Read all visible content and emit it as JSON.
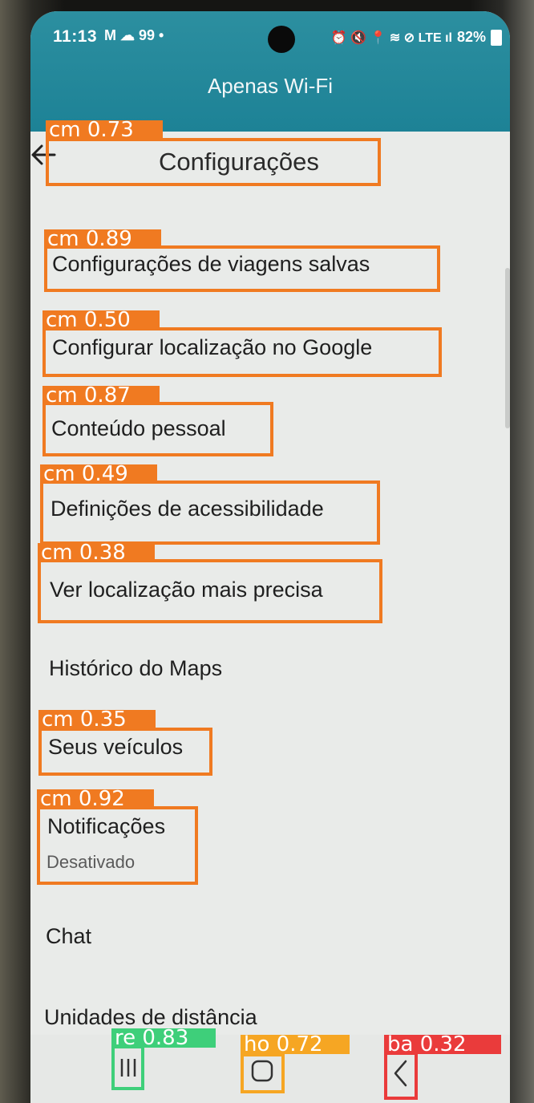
{
  "status_bar": {
    "time": "11:13",
    "left_icons": "M ☁ 99 •",
    "right_icons": "⏰ 🔇 📍 ≋ ⊘ LTE ıl",
    "battery": "82%"
  },
  "app_bar": {
    "title": "Apenas Wi-Fi"
  },
  "header": {
    "back_icon": "arrow-left-icon",
    "title": "Configurações"
  },
  "menu": [
    {
      "label": "Configurações de viagens salvas"
    },
    {
      "label": "Configurar localização no Google"
    },
    {
      "label": "Conteúdo pessoal"
    },
    {
      "label": "Definições de acessibilidade"
    },
    {
      "label": "Ver localização mais precisa"
    },
    {
      "label": "Histórico do Maps"
    },
    {
      "label": "Seus veículos"
    },
    {
      "label": "Notificações",
      "sublabel": "Desativado"
    },
    {
      "label": "Chat"
    },
    {
      "label": "Unidades de distância"
    }
  ],
  "detections": [
    {
      "label": "cm 0.73",
      "color": "#f07a21"
    },
    {
      "label": "cm 0.89",
      "color": "#f07a21"
    },
    {
      "label": "cm 0.50",
      "color": "#f07a21"
    },
    {
      "label": "cm 0.87",
      "color": "#f07a21"
    },
    {
      "label": "cm 0.49",
      "color": "#f07a21"
    },
    {
      "label": "cm 0.38",
      "color": "#f07a21"
    },
    {
      "label": "cm 0.35",
      "color": "#f07a21"
    },
    {
      "label": "cm 0.92",
      "color": "#f07a21"
    },
    {
      "label": "re 0.83",
      "color": "#3ecf7a"
    },
    {
      "label": "ho 0.72",
      "color": "#f6a623"
    },
    {
      "label": "ba 0.32",
      "color": "#ea3b3b"
    }
  ],
  "navbar": {
    "recents_icon": "recents-icon",
    "home_icon": "home-icon",
    "back_icon": "back-icon"
  }
}
